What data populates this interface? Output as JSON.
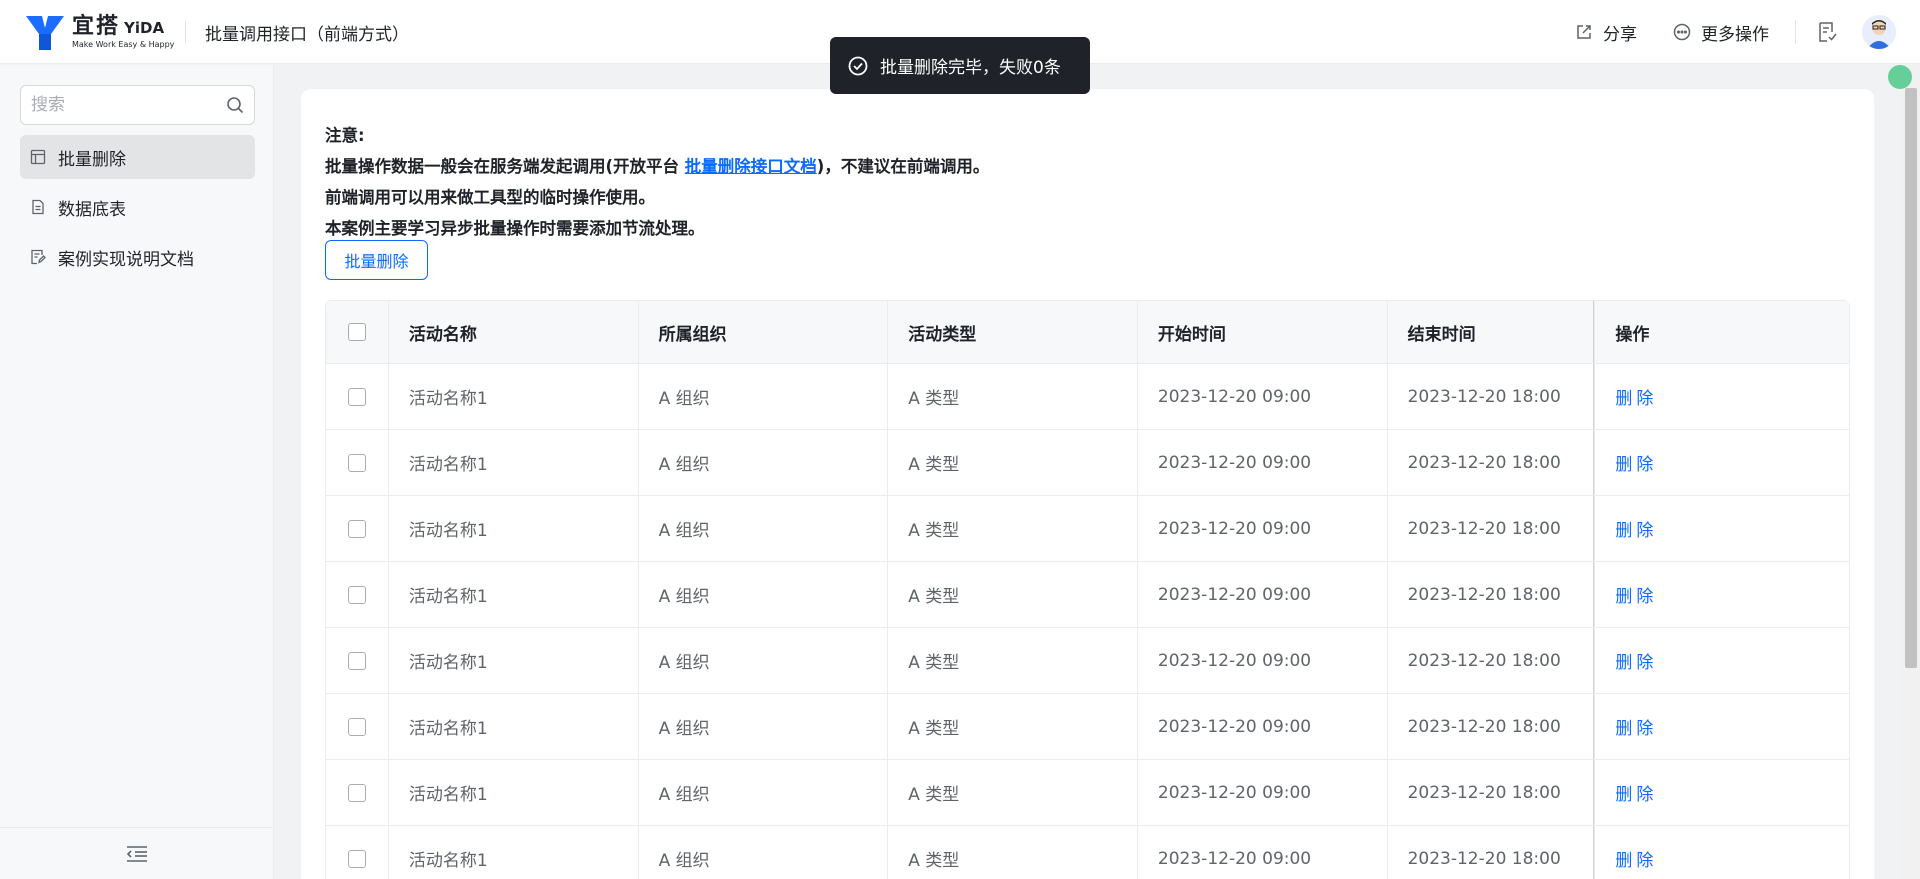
{
  "header": {
    "logo_cn": "宜搭",
    "logo_en": "YiDA",
    "logo_slogan": "Make Work Easy & Happy",
    "app_title": "批量调用接口（前端方式）",
    "share_label": "分享",
    "more_label": "更多操作"
  },
  "sidebar": {
    "search_placeholder": "搜索",
    "items": [
      {
        "label": "批量删除",
        "icon": "form-icon",
        "active": true
      },
      {
        "label": "数据底表",
        "icon": "document-icon",
        "active": false
      },
      {
        "label": "案例实现说明文档",
        "icon": "edit-doc-icon",
        "active": false
      }
    ]
  },
  "notice": {
    "title": "注意:",
    "line1_prefix": "批量操作数据一般会在服务端发起调用(开放平台 ",
    "line1_link": "批量删除接口文档",
    "line1_suffix": ")，不建议在前端调用。",
    "line2": "前端调用可以用来做工具型的临时操作使用。",
    "line3": "本案例主要学习异步批量操作时需要添加节流处理。"
  },
  "batch_delete_button": "批量删除",
  "table": {
    "columns": [
      "活动名称",
      "所属组织",
      "活动类型",
      "开始时间",
      "结束时间",
      "操作"
    ],
    "rows": [
      [
        "活动名称1",
        "A 组织",
        "A 类型",
        "2023-12-20 09:00",
        "2023-12-20 18:00",
        "删除"
      ],
      [
        "活动名称1",
        "A 组织",
        "A 类型",
        "2023-12-20 09:00",
        "2023-12-20 18:00",
        "删除"
      ],
      [
        "活动名称1",
        "A 组织",
        "A 类型",
        "2023-12-20 09:00",
        "2023-12-20 18:00",
        "删除"
      ],
      [
        "活动名称1",
        "A 组织",
        "A 类型",
        "2023-12-20 09:00",
        "2023-12-20 18:00",
        "删除"
      ],
      [
        "活动名称1",
        "A 组织",
        "A 类型",
        "2023-12-20 09:00",
        "2023-12-20 18:00",
        "删除"
      ],
      [
        "活动名称1",
        "A 组织",
        "A 类型",
        "2023-12-20 09:00",
        "2023-12-20 18:00",
        "删除"
      ],
      [
        "活动名称1",
        "A 组织",
        "A 类型",
        "2023-12-20 09:00",
        "2023-12-20 18:00",
        "删除"
      ],
      [
        "活动名称1",
        "A 组织",
        "A 类型",
        "2023-12-20 09:00",
        "2023-12-20 18:00",
        "删除"
      ]
    ]
  },
  "toast": {
    "message": "批量删除完毕，失败0条",
    "icon": "check-circle-icon"
  },
  "colors": {
    "primary": "#0a6cff",
    "toast_bg": "#1f2329",
    "sidebar_active": "#e3e4e6"
  }
}
